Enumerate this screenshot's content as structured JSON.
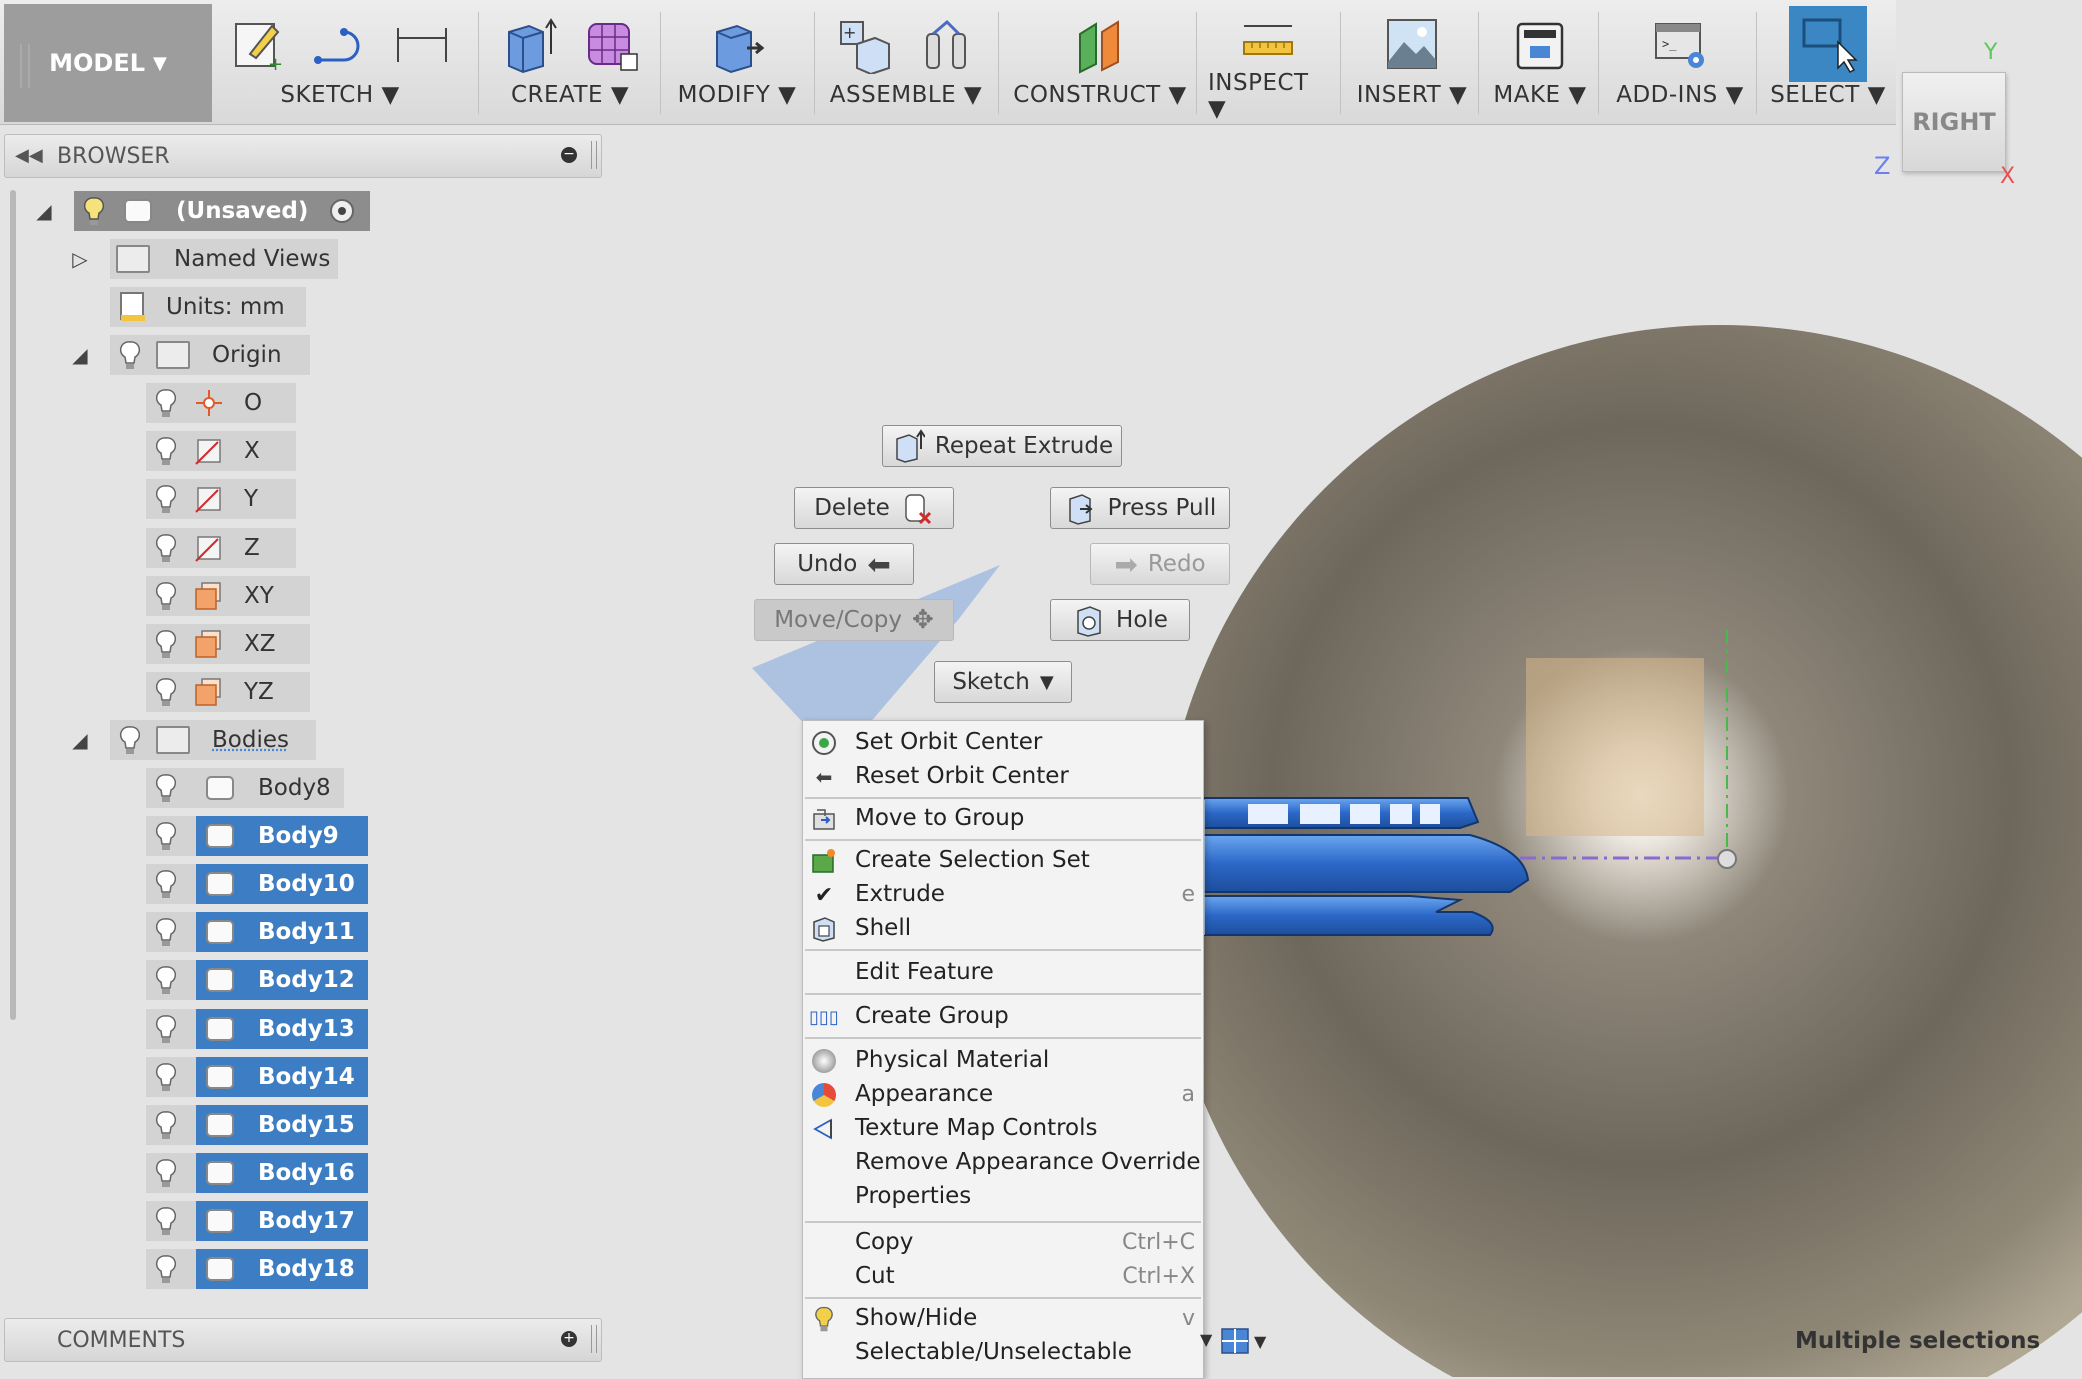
{
  "toolbar": {
    "model_label": "MODEL",
    "groups": [
      {
        "label": "SKETCH",
        "icons": [
          "sketch-create-icon",
          "sketch-arc-icon",
          "sketch-dimension-icon"
        ]
      },
      {
        "label": "CREATE",
        "icons": [
          "box-extrude-icon",
          "form-grid-icon"
        ]
      },
      {
        "label": "MODIFY",
        "icons": [
          "press-pull-icon"
        ]
      },
      {
        "label": "ASSEMBLE",
        "icons": [
          "new-component-icon",
          "joint-icon"
        ]
      },
      {
        "label": "CONSTRUCT",
        "icons": [
          "construct-plane-icon"
        ]
      },
      {
        "label": "INSPECT",
        "icons": [
          "measure-icon"
        ]
      },
      {
        "label": "INSERT",
        "icons": [
          "insert-image-icon"
        ]
      },
      {
        "label": "MAKE",
        "icons": [
          "3d-print-icon"
        ]
      },
      {
        "label": "ADD-INS",
        "icons": [
          "scripts-icon"
        ]
      },
      {
        "label": "SELECT",
        "icons": [
          "select-cursor-icon"
        ]
      }
    ]
  },
  "browser": {
    "title": "BROWSER",
    "root_label": "(Unsaved)",
    "named_views": "Named Views",
    "units": "Units: mm",
    "origin": "Origin",
    "origin_items": [
      "O",
      "X",
      "Y",
      "Z",
      "XY",
      "XZ",
      "YZ"
    ],
    "bodies": "Bodies",
    "body_items": [
      "Body8",
      "Body9",
      "Body10",
      "Body11",
      "Body12",
      "Body13",
      "Body14",
      "Body15",
      "Body16",
      "Body17",
      "Body18"
    ]
  },
  "comments": {
    "title": "COMMENTS"
  },
  "marking_menu": {
    "repeat": "Repeat Extrude",
    "delete": "Delete",
    "press_pull": "Press Pull",
    "undo": "Undo",
    "redo": "Redo",
    "move_copy": "Move/Copy",
    "hole": "Hole",
    "sketch": "Sketch"
  },
  "context_menu": {
    "set_orbit": "Set Orbit Center",
    "reset_orbit": "Reset Orbit Center",
    "move_group": "Move to Group",
    "create_selection_set": "Create Selection Set",
    "extrude": "Extrude",
    "extrude_key": "e",
    "shell": "Shell",
    "edit_feature": "Edit Feature",
    "create_group": "Create Group",
    "physical_material": "Physical Material",
    "appearance": "Appearance",
    "appearance_key": "a",
    "texture_map": "Texture Map Controls",
    "remove_override": "Remove Appearance Override",
    "properties": "Properties",
    "copy": "Copy",
    "copy_key": "Ctrl+C",
    "cut": "Cut",
    "cut_key": "Ctrl+X",
    "show_hide": "Show/Hide",
    "show_hide_key": "v",
    "selectable": "Selectable/Unselectable"
  },
  "viewcube": {
    "face": "RIGHT",
    "axis_y": "Y",
    "axis_z": "Z",
    "axis_x": "X"
  },
  "status": {
    "text": "Multiple selections"
  },
  "colors": {
    "selection_blue": "#3d7dc4",
    "body_blue": "#2f6fd0",
    "toolbar_bg": "#e0e0e0"
  }
}
